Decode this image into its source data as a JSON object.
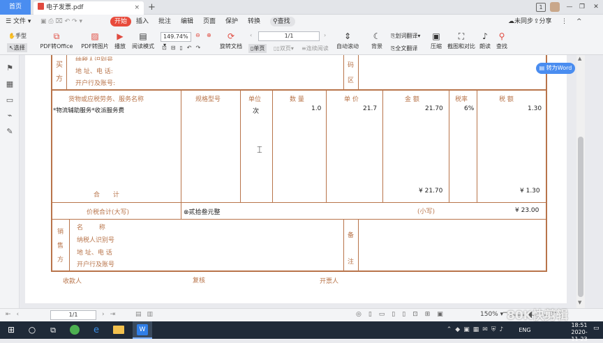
{
  "titlebar": {
    "home_tab": "首页",
    "doc_tab": "电子发票.pdf",
    "doc_tab_close": "×",
    "new_tab": "+",
    "badge": "1",
    "min": "—",
    "restore": "❐",
    "close": "✕"
  },
  "menubar": {
    "file": "文件",
    "items": [
      "开始",
      "插入",
      "批注",
      "编辑",
      "页面",
      "保护",
      "转换"
    ],
    "search": "查找",
    "sync": "未同步",
    "share": "分享",
    "more": "⋮",
    "collapse": "^"
  },
  "ribbon": {
    "hand": "手型",
    "select": "选择",
    "pdf_to_office": "PDF转Office",
    "pdf_to_image": "PDF转图片",
    "play": "播放",
    "read_mode": "阅读模式",
    "zoom_value": "149.74%",
    "page_value": "1/1",
    "rotate_doc": "旋转文档",
    "single": "单页",
    "double": "双页",
    "continuous": "连续阅读",
    "auto_scroll": "自动滚动",
    "background": "背景",
    "word_translate": "划词翻译",
    "full_translate": "全文翻译",
    "compress": "压缩",
    "screenshot_compare": "截图和对比",
    "read_aloud": "朗读",
    "find": "查找"
  },
  "invoice": {
    "buyer_vertical": [
      "买",
      "方"
    ],
    "buyer_labels": [
      "纳税人识别号",
      "地 址、电 话:",
      "开户行及账号:"
    ],
    "pwd_vertical": [
      "码",
      "区"
    ],
    "headers": {
      "name": "货物或应税劳务、服务名称",
      "spec": "规格型号",
      "unit": "单位",
      "qty": "数 量",
      "price": "单 价",
      "amount": "金 额",
      "rate": "税率",
      "tax": "税 额"
    },
    "item": {
      "name": "*物流辅助服务*收派服务费",
      "unit": "次",
      "qty": "1.0",
      "price": "21.7",
      "amount": "21.70",
      "rate": "6%",
      "tax": "1.30"
    },
    "total_label": "合 计",
    "total_amount": "¥ 21.70",
    "total_tax": "¥ 1.30",
    "price_tax_label": "价税合计(大写)",
    "price_tax_upper": "贰拾叁元整",
    "small_label": "(小写)",
    "price_tax_lower": "¥ 23.00",
    "seller_vertical": [
      "销",
      "售",
      "方"
    ],
    "seller_labels": [
      "名 称",
      "纳税人识别号",
      "地 址、电 话",
      "开户行及账号"
    ],
    "remark_vertical": [
      "备",
      "注"
    ],
    "footer": {
      "payee": "收款人",
      "review": "复核",
      "drawer": "开票人"
    }
  },
  "to_word": "转为Word",
  "statusbar": {
    "page": "1/1",
    "zoom": "150%",
    "zoom_minus": "−",
    "zoom_plus": "+"
  },
  "watermark": "80K快剪辑",
  "taskbar": {
    "time": "18:51",
    "date": "2020-11-23",
    "lang": "ENG"
  },
  "colors": {
    "accent": "#4a8df0",
    "invoice": "#b8744a",
    "start": "#e84b3c"
  }
}
